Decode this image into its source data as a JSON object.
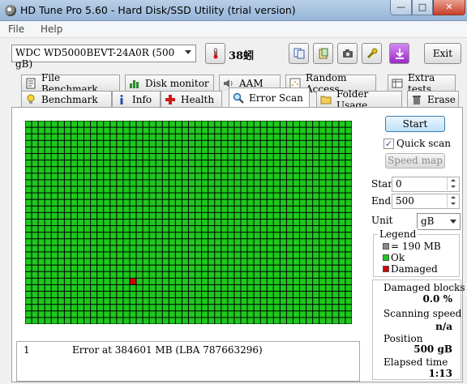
{
  "window": {
    "title": "HD Tune Pro 5.60 - Hard Disk/SSD Utility (trial version)",
    "min_glyph": "—",
    "max_glyph": "□",
    "close_glyph": "✕"
  },
  "menu": {
    "file": "File",
    "help": "Help"
  },
  "toolbar": {
    "drive": "WDC WD5000BEVT-24A0R (500 gB)",
    "temperature": "38蚓",
    "exit": "Exit"
  },
  "tabs_top": [
    "File Benchmark",
    "Disk monitor",
    "AAM",
    "Random Access",
    "Extra tests"
  ],
  "tabs_bottom": [
    "Benchmark",
    "Info",
    "Health",
    "Error Scan",
    "Folder Usage",
    "Erase"
  ],
  "active_tab": "Error Scan",
  "scan_grid": {
    "columns": 50,
    "rows": 31,
    "ok_color": "#1ec81e",
    "damaged_color": "#d40000",
    "damaged_blocks": [
      {
        "row": 24,
        "col": 16
      }
    ]
  },
  "log": {
    "entries": [
      {
        "num": "1",
        "message": "Error at 384601 MB (LBA 787663296)"
      }
    ]
  },
  "controls": {
    "start": "Start",
    "quick_scan": "Quick scan",
    "quick_scan_checked": true,
    "speed_map": "Speed map",
    "start_label": "Start",
    "start_value": "0",
    "end_label": "End",
    "end_value": "500",
    "unit_label": "Unit",
    "unit_value": "gB"
  },
  "legend": {
    "title": "Legend",
    "block": "= 190 MB",
    "ok": "Ok",
    "damaged": "Damaged"
  },
  "stats": {
    "damaged_label": "Damaged blocks",
    "damaged_value": "0.0  %",
    "speed_label": "Scanning speed",
    "speed_value": "n/a",
    "position_label": "Position",
    "position_value": "500 gB",
    "elapsed_label": "Elapsed time",
    "elapsed_value": "1:13"
  }
}
